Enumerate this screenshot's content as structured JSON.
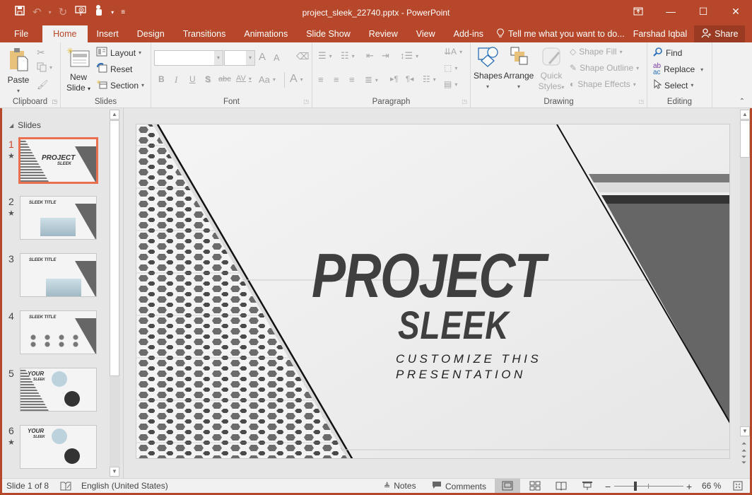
{
  "window": {
    "title": "project_sleek_22740.pptx - PowerPoint",
    "controls": {
      "restore_ribbon": "ribbon-display-icon",
      "minimize": "—",
      "maximize": "☐",
      "close": "✕"
    }
  },
  "qat": {
    "save": "save-icon",
    "undo": "undo-icon",
    "redo": "redo-icon",
    "start_from_beginning": "slideshow-icon",
    "touch_mode": "touch-icon",
    "customize": "customize-icon"
  },
  "tabs": [
    "File",
    "Home",
    "Insert",
    "Design",
    "Transitions",
    "Animations",
    "Slide Show",
    "Review",
    "View",
    "Add-ins"
  ],
  "active_tab": "Home",
  "tell_me": "Tell me what you want to do...",
  "user": "Farshad Iqbal",
  "share": "Share",
  "ribbon": {
    "clipboard": {
      "label": "Clipboard",
      "paste": "Paste"
    },
    "slides": {
      "label": "Slides",
      "new_slide_1": "New",
      "new_slide_2": "Slide",
      "layout": "Layout",
      "reset": "Reset",
      "section": "Section"
    },
    "font": {
      "label": "Font",
      "font_name": "",
      "font_size": "",
      "grow": "A",
      "shrink": "A",
      "bold": "B",
      "italic": "I",
      "underline": "U",
      "shadow": "S",
      "strike": "abc",
      "spacing": "AV",
      "case": "Aa",
      "color": "A"
    },
    "paragraph": {
      "label": "Paragraph"
    },
    "drawing": {
      "label": "Drawing",
      "shapes": "Shapes",
      "arrange": "Arrange",
      "quick_styles_1": "Quick",
      "quick_styles_2": "Styles",
      "shape_fill": "Shape Fill",
      "shape_outline": "Shape Outline",
      "shape_effects": "Shape Effects"
    },
    "editing": {
      "label": "Editing",
      "find": "Find",
      "replace": "Replace",
      "select": "Select"
    }
  },
  "slides_panel": {
    "header": "Slides",
    "thumbnails": [
      {
        "number": "1",
        "star": true,
        "title": "PROJECT",
        "subtitle": "SLEEK",
        "selected": true
      },
      {
        "number": "2",
        "star": true,
        "title": "SLEEK TITLE",
        "selected": false
      },
      {
        "number": "3",
        "star": false,
        "title": "SLEEK TITLE",
        "selected": false
      },
      {
        "number": "4",
        "star": false,
        "title": "SLEEK TITLE",
        "selected": false
      },
      {
        "number": "5",
        "star": false,
        "title": "YOUR",
        "subtitle": "SLEEK",
        "selected": false
      },
      {
        "number": "6",
        "star": true,
        "title": "YOUR",
        "subtitle": "SLEEK",
        "selected": false
      }
    ]
  },
  "slide": {
    "title": "PROJECT",
    "subtitle": "SLEEK",
    "tagline_1": "CUSTOMIZE THIS",
    "tagline_2": "PRESENTATION"
  },
  "status": {
    "slide_info": "Slide 1 of 8",
    "language": "English (United States)",
    "notes": "Notes",
    "comments": "Comments",
    "zoom_percent": 66,
    "zoom_label": "66 %"
  },
  "colors": {
    "brand": "#b7472a",
    "selected_thumb": "#e8704f",
    "ribbon_bg": "#f1f1f1"
  }
}
